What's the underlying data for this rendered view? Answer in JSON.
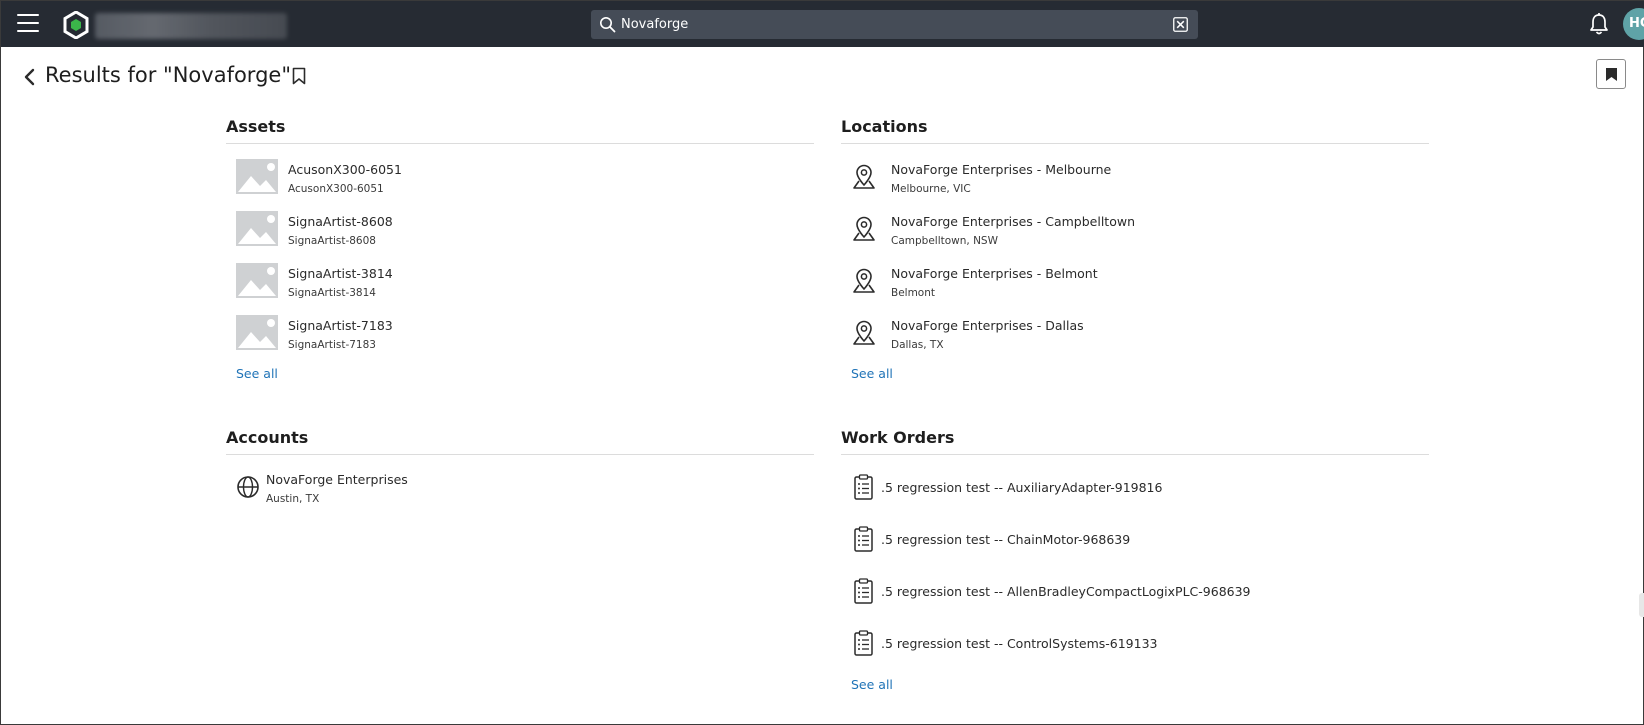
{
  "topbar": {
    "search_value": "Novaforge",
    "avatar_initials": "HC"
  },
  "header": {
    "title": "Results for \"Novaforge\""
  },
  "assets": {
    "title": "Assets",
    "items": [
      {
        "name": "AcusonX300-6051",
        "sub": "AcusonX300-6051"
      },
      {
        "name": "SignaArtist-8608",
        "sub": "SignaArtist-8608"
      },
      {
        "name": "SignaArtist-3814",
        "sub": "SignaArtist-3814"
      },
      {
        "name": "SignaArtist-7183",
        "sub": "SignaArtist-7183"
      }
    ],
    "see_all": "See all"
  },
  "locations": {
    "title": "Locations",
    "items": [
      {
        "name": "NovaForge Enterprises - Melbourne",
        "sub": "Melbourne, VIC"
      },
      {
        "name": "NovaForge Enterprises - Campbelltown",
        "sub": "Campbelltown, NSW"
      },
      {
        "name": "NovaForge Enterprises - Belmont",
        "sub": "Belmont"
      },
      {
        "name": "NovaForge Enterprises - Dallas",
        "sub": "Dallas, TX"
      }
    ],
    "see_all": "See all"
  },
  "accounts": {
    "title": "Accounts",
    "items": [
      {
        "name": "NovaForge Enterprises",
        "sub": "Austin, TX"
      }
    ]
  },
  "work_orders": {
    "title": "Work Orders",
    "items": [
      {
        "name": ".5 regression test -- AuxiliaryAdapter-919816"
      },
      {
        "name": ".5 regression test -- ChainMotor-968639"
      },
      {
        "name": ".5 regression test -- AllenBradleyCompactLogixPLC-968639"
      },
      {
        "name": ".5 regression test -- ControlSystems-619133"
      }
    ],
    "see_all": "See all"
  },
  "icons": {
    "menu": "hamburger-menu-icon",
    "search": "search-icon",
    "clear": "clear-search-icon",
    "notifications": "bell-icon",
    "back": "chevron-left-icon",
    "bookmark": "bookmark-icon",
    "asset_thumb": "image-placeholder-icon",
    "location": "map-pin-icon",
    "account": "globe-icon",
    "work_order": "clipboard-list-icon"
  },
  "colors": {
    "topbar": "#262b33",
    "search_bg": "#454c57",
    "link": "#1f73b7",
    "logo_green": "#3bb54a",
    "avatar": "#5fa3a7"
  }
}
